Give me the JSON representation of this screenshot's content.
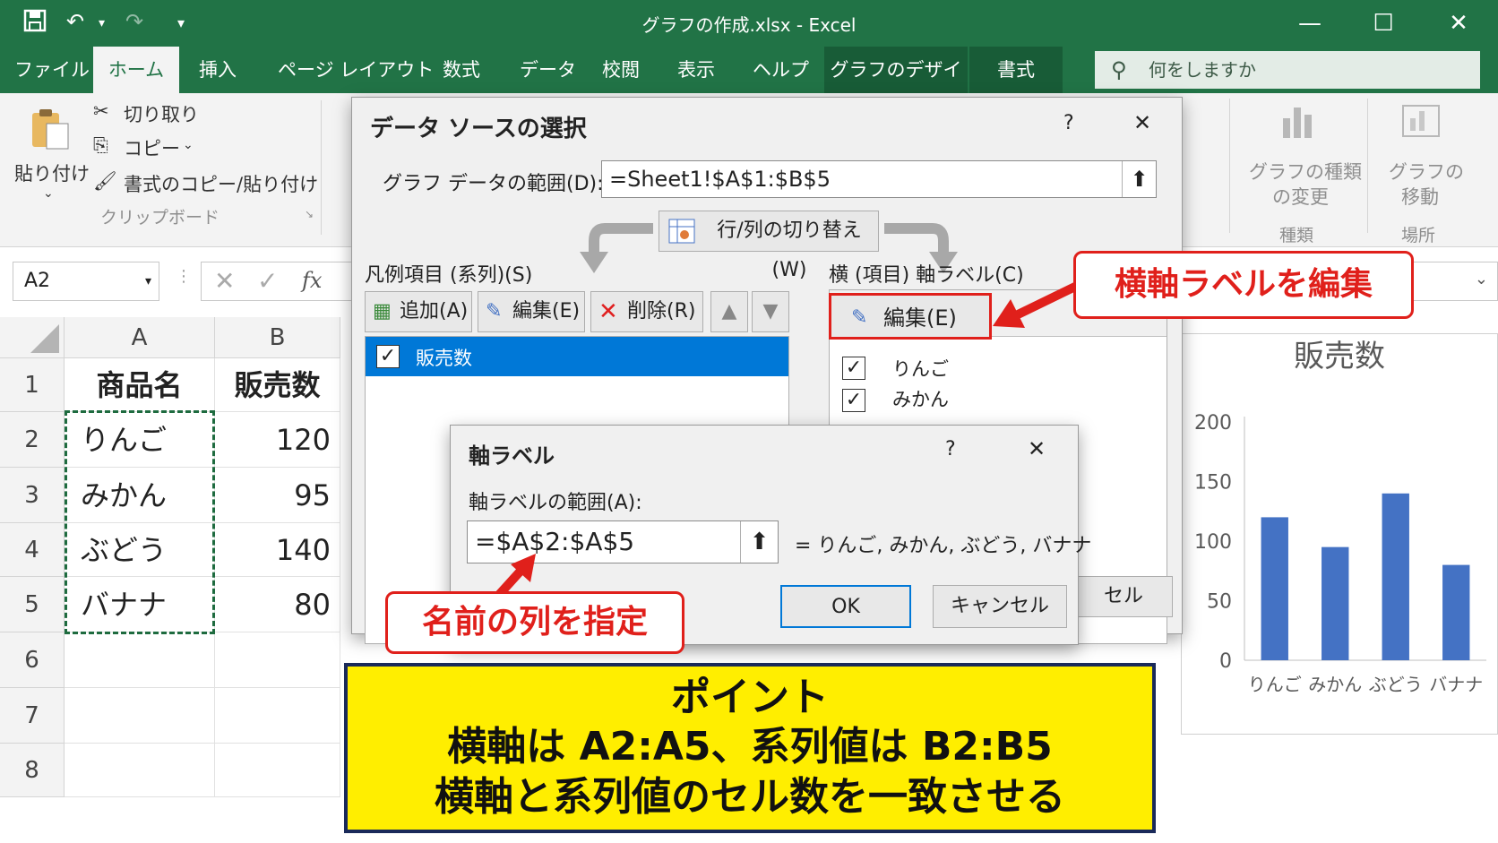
{
  "window": {
    "title": "グラフの作成.xlsx  -  Excel",
    "minimize": "—",
    "maximize": "☐",
    "close": "✕"
  },
  "tabs": [
    "ファイル",
    "ホーム",
    "挿入",
    "ページ レイアウト",
    "数式",
    "データ",
    "校閲",
    "表示",
    "ヘルプ",
    "グラフのデザイン",
    "書式"
  ],
  "tellme": "何をしますか",
  "ribbon": {
    "paste": "貼り付け",
    "cut": "切り取り",
    "copy": "コピー",
    "format_painter": "書式のコピー/貼り付け",
    "clipboard_group": "クリップボード",
    "change_type_1": "グラフの種類",
    "change_type_2": "の変更",
    "type_group": "種類",
    "move_1": "グラフの",
    "move_2": "移動",
    "location_group": "場所"
  },
  "formula_bar": {
    "namebox": "A2",
    "fx": "fx"
  },
  "sheet": {
    "columns": [
      "A",
      "B"
    ],
    "rows": [
      "1",
      "2",
      "3",
      "4",
      "5",
      "6",
      "7",
      "8"
    ],
    "header": {
      "a": "商品名",
      "b": "販売数"
    },
    "data": [
      {
        "name": "りんご",
        "value": "120"
      },
      {
        "name": "みかん",
        "value": "95"
      },
      {
        "name": "ぶどう",
        "value": "140"
      },
      {
        "name": "バナナ",
        "value": "80"
      }
    ]
  },
  "select_source_dialog": {
    "title": "データ ソースの選択",
    "help": "?",
    "close": "✕",
    "range_label": "グラフ データの範囲(D):",
    "range_value": "=Sheet1!$A$1:$B$5",
    "switch_button": "行/列の切り替え(W)",
    "series_label": "凡例項目 (系列)(S)",
    "add": "追加(A)",
    "edit": "編集(E)",
    "delete": "削除(R)",
    "series_items": [
      "販売数"
    ],
    "axis_label_header": "横 (項目) 軸ラベル(C)",
    "axis_edit": "編集(E)",
    "axis_items": [
      "りんご",
      "みかん"
    ],
    "cancel_partial": "セル"
  },
  "axis_dialog": {
    "title": "軸ラベル",
    "help": "?",
    "close": "✕",
    "range_label": "軸ラベルの範囲(A):",
    "range_value": "=$A$2:$A$5",
    "preview": "=  りんご, みかん, ぶどう, バナナ",
    "ok": "OK",
    "cancel": "キャンセル"
  },
  "callouts": {
    "edit_axis": "横軸ラベルを編集",
    "specify_column": "名前の列を指定"
  },
  "point_box": {
    "heading": "ポイント",
    "line1": "横軸は A2:A5、系列値は B2:B5",
    "line2": "横軸と系列値のセル数を一致させる"
  },
  "chart_data": {
    "type": "bar",
    "title": "販売数",
    "categories": [
      "りんご",
      "みかん",
      "ぶどう",
      "バナナ"
    ],
    "values": [
      120,
      95,
      140,
      80
    ],
    "ylim": [
      0,
      200
    ],
    "yticks": [
      0,
      50,
      100,
      150,
      200
    ],
    "bar_color": "#4472c4",
    "grid": false
  },
  "colors": {
    "excel_green": "#217346",
    "callout_red": "#e0201b",
    "point_yellow": "#ffee00",
    "selection_blue": "#0078d7"
  }
}
